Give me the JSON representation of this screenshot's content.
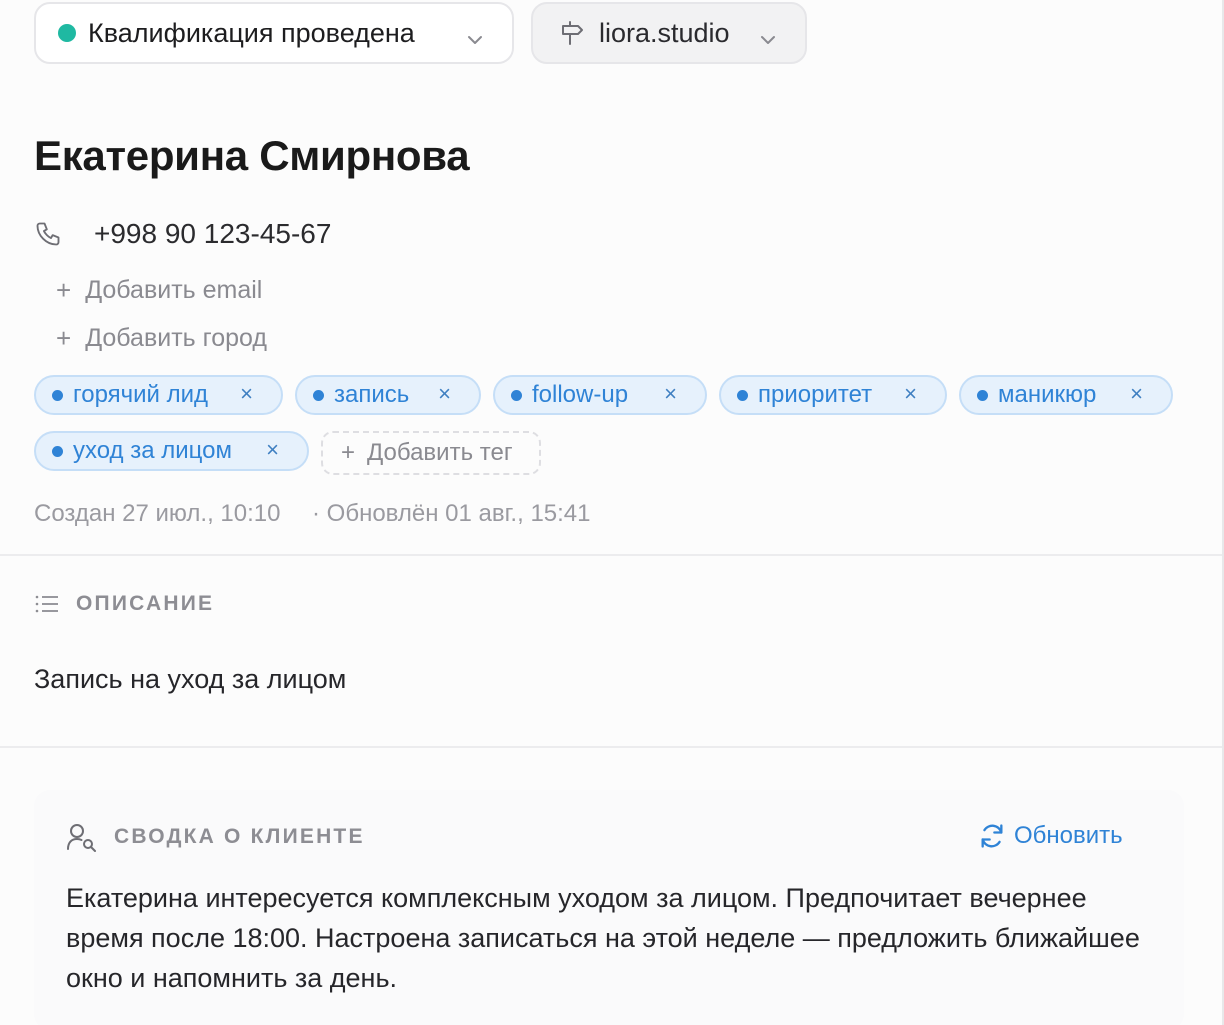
{
  "status": {
    "label": "Квалификация проведена",
    "dot_color": "#1fb9a2",
    "icon": "chevron-down-icon"
  },
  "source": {
    "label": "liora.studio",
    "icon": "signpost-icon"
  },
  "contact": {
    "name": "Екатерина Смирнова",
    "phone": "+998 90 123-45-67",
    "add_email": "Добавить email",
    "add_city": "Добавить город"
  },
  "tags": [
    {
      "label": "горячий лид"
    },
    {
      "label": "запись"
    },
    {
      "label": "follow-up"
    },
    {
      "label": "приоритет"
    },
    {
      "label": "маникюр"
    },
    {
      "label": "уход за лицом"
    }
  ],
  "add_tag": "Добавить тег",
  "meta": {
    "created": "Создан 27 июл., 10:10",
    "updated": "· Обновлён 01 авг., 15:41"
  },
  "description": {
    "heading": "ОПИСАНИЕ",
    "text": "Запись на уход за лицом"
  },
  "summary": {
    "heading": "СВОДКА О КЛИЕНТЕ",
    "refresh": "Обновить",
    "text": "Екатерина интересуется комплексным уходом за лицом. Предпочитает вечернее время после 18:00. Настроена записаться на этой неделе — предложить ближайшее окно и напомнить за день."
  },
  "colors": {
    "accent": "#2f83d6",
    "tag_bg": "#e6f1fc",
    "status": "#1fb9a2"
  }
}
